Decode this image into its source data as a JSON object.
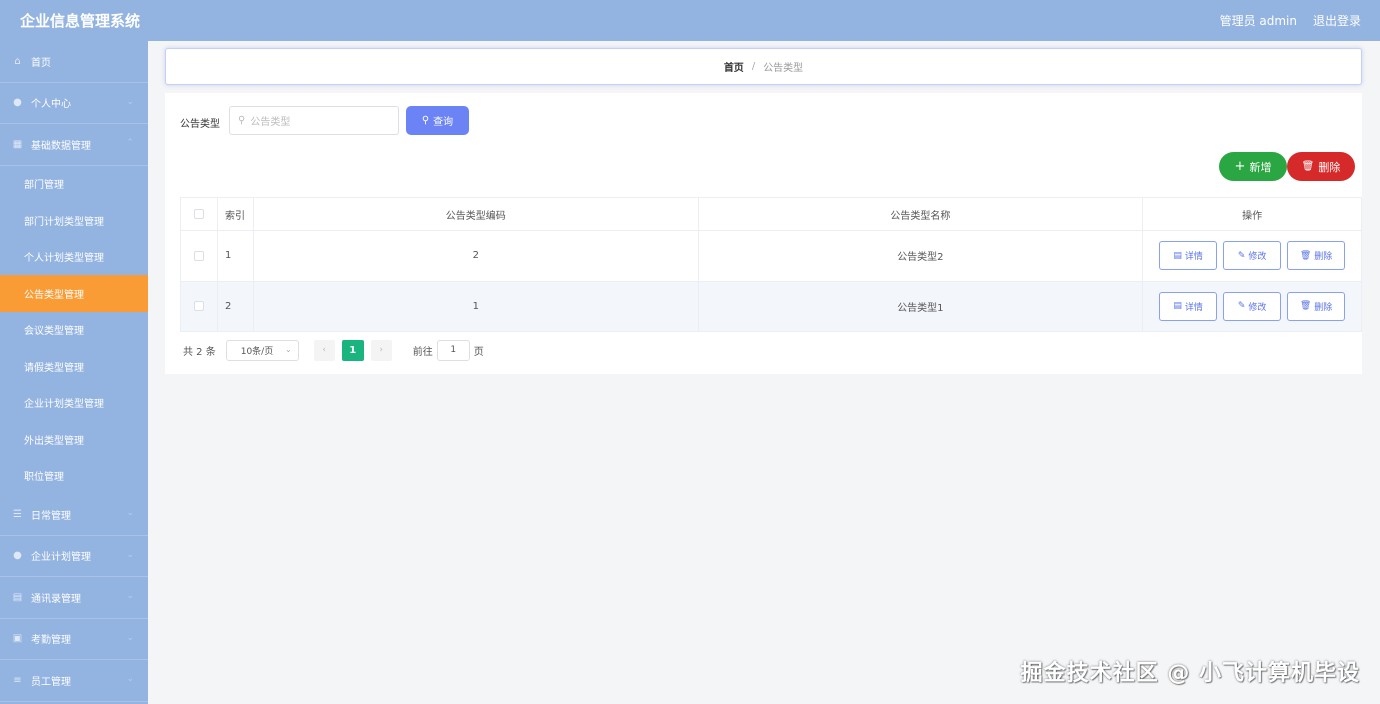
{
  "header": {
    "app_title": "企业信息管理系统",
    "user_label": "管理员 admin",
    "logout_label": "退出登录"
  },
  "sidebar": {
    "menus_top": [
      {
        "label": "首页",
        "icon": "home-icon"
      },
      {
        "label": "个人中心",
        "icon": "user-icon"
      },
      {
        "label": "基础数据管理",
        "icon": "data-icon"
      }
    ],
    "submenu": [
      {
        "label": "部门管理"
      },
      {
        "label": "部门计划类型管理"
      },
      {
        "label": "个人计划类型管理"
      },
      {
        "label": "公告类型管理",
        "active": true
      },
      {
        "label": "会议类型管理"
      },
      {
        "label": "请假类型管理"
      },
      {
        "label": "企业计划类型管理"
      },
      {
        "label": "外出类型管理"
      },
      {
        "label": "职位管理"
      }
    ],
    "menus_bottom": [
      {
        "label": "日常管理",
        "icon": "list-icon"
      },
      {
        "label": "企业计划管理",
        "icon": "plan-icon"
      },
      {
        "label": "通讯录管理",
        "icon": "contacts-icon"
      },
      {
        "label": "考勤管理",
        "icon": "attendance-icon"
      },
      {
        "label": "员工管理",
        "icon": "staff-icon"
      }
    ],
    "active_color": "#fa9c36"
  },
  "breadcrumb": {
    "home": "首页",
    "separator": "/",
    "current": "公告类型"
  },
  "search": {
    "label": "公告类型",
    "placeholder": "公告类型",
    "button_label": "查询"
  },
  "actions": {
    "add_label": "新增",
    "delete_label": "删除"
  },
  "table": {
    "headers": {
      "index": "索引",
      "code": "公告类型编码",
      "name": "公告类型名称",
      "ops": "操作"
    },
    "rows": [
      {
        "index": "1",
        "code": "2",
        "name": "公告类型2"
      },
      {
        "index": "2",
        "code": "1",
        "name": "公告类型1"
      }
    ],
    "row_actions": {
      "detail": "详情",
      "edit": "修改",
      "delete": "删除"
    }
  },
  "pagination": {
    "total": "共 2 条",
    "page_size": "10条/页",
    "current_page": "1",
    "goto_label": "前往",
    "goto_value": "1",
    "page_unit": "页"
  },
  "watermark": "掘金技术社区 @ 小飞计算机毕设",
  "colors": {
    "header_bg": "#93b3e0",
    "primary": "#6b83f5",
    "success": "#2aa642",
    "danger": "#d62a2a",
    "pager_active": "#1ab57e"
  }
}
